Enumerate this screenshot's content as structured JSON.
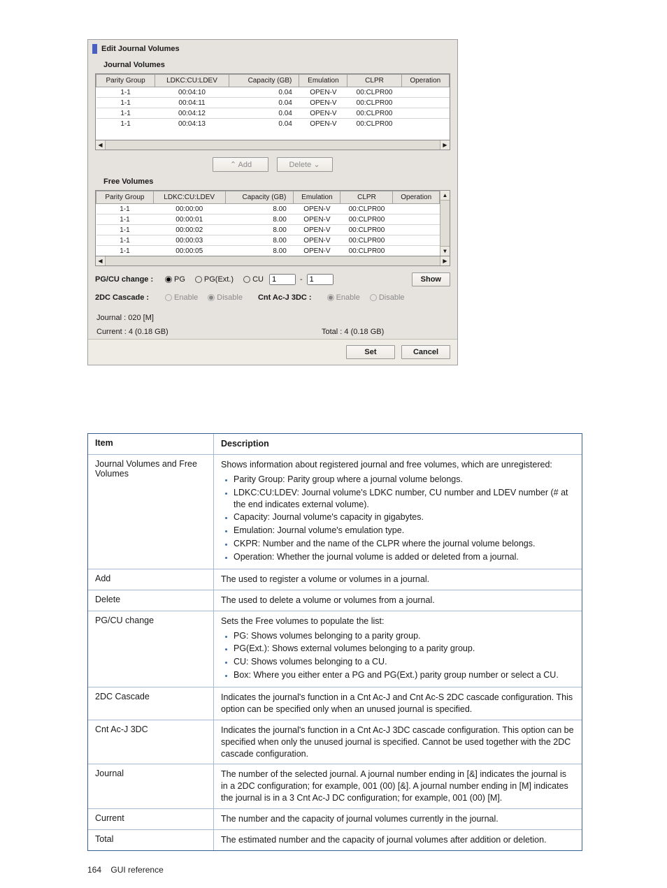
{
  "window": {
    "title": "Edit Journal Volumes",
    "section1_title": "Journal Volumes",
    "section2_title": "Free Volumes",
    "columns": {
      "parity_group": "Parity Group",
      "ldkc": "LDKC:CU:LDEV",
      "capacity": "Capacity (GB)",
      "emulation": "Emulation",
      "clpr": "CLPR",
      "operation": "Operation"
    },
    "journal_rows": [
      {
        "pg": "1-1",
        "ldkc": "00:04:10",
        "cap": "0.04",
        "emu": "OPEN-V",
        "clpr": "00:CLPR00",
        "op": ""
      },
      {
        "pg": "1-1",
        "ldkc": "00:04:11",
        "cap": "0.04",
        "emu": "OPEN-V",
        "clpr": "00:CLPR00",
        "op": ""
      },
      {
        "pg": "1-1",
        "ldkc": "00:04:12",
        "cap": "0.04",
        "emu": "OPEN-V",
        "clpr": "00:CLPR00",
        "op": ""
      },
      {
        "pg": "1-1",
        "ldkc": "00:04:13",
        "cap": "0.04",
        "emu": "OPEN-V",
        "clpr": "00:CLPR00",
        "op": ""
      }
    ],
    "free_rows": [
      {
        "pg": "1-1",
        "ldkc": "00:00:00",
        "cap": "8.00",
        "emu": "OPEN-V",
        "clpr": "00:CLPR00",
        "op": ""
      },
      {
        "pg": "1-1",
        "ldkc": "00:00:01",
        "cap": "8.00",
        "emu": "OPEN-V",
        "clpr": "00:CLPR00",
        "op": ""
      },
      {
        "pg": "1-1",
        "ldkc": "00:00:02",
        "cap": "8.00",
        "emu": "OPEN-V",
        "clpr": "00:CLPR00",
        "op": ""
      },
      {
        "pg": "1-1",
        "ldkc": "00:00:03",
        "cap": "8.00",
        "emu": "OPEN-V",
        "clpr": "00:CLPR00",
        "op": ""
      },
      {
        "pg": "1-1",
        "ldkc": "00:00:05",
        "cap": "8.00",
        "emu": "OPEN-V",
        "clpr": "00:CLPR00",
        "op": ""
      }
    ],
    "add_btn": "Add",
    "delete_btn": "Delete",
    "pg_cu_label": "PG/CU change :",
    "pg": "PG",
    "pgext": "PG(Ext.)",
    "cu": "CU",
    "field1": "1",
    "dash": "-",
    "field2": "1",
    "show": "Show",
    "cascade_label": "2DC Cascade :",
    "enable": "Enable",
    "disable": "Disable",
    "cnt_label": "Cnt Ac-J 3DC :",
    "journal_info": "Journal : 020 [M]",
    "current_info": "Current : 4 (0.18 GB)",
    "total_info": "Total : 4 (0.18 GB)",
    "set": "Set",
    "cancel": "Cancel"
  },
  "desc": {
    "h_item": "Item",
    "h_desc": "Description",
    "rows": [
      {
        "item": "Journal Volumes and Free Volumes",
        "intro": "Shows information about registered journal and free volumes, which are unregistered:",
        "bullets": [
          "Parity Group: Parity group where a journal volume belongs.",
          "LDKC:CU:LDEV: Journal volume's LDKC number, CU number and LDEV number (# at the end indicates external volume).",
          "Capacity: Journal volume's capacity in gigabytes.",
          "Emulation: Journal volume's emulation type.",
          "CKPR: Number and the name of the CLPR where the journal volume belongs.",
          "Operation: Whether the journal volume is added or deleted from a journal."
        ]
      },
      {
        "item": "Add",
        "text": "The used to register a volume or volumes in a journal."
      },
      {
        "item": "Delete",
        "text": "The used to delete a volume or volumes from a journal."
      },
      {
        "item": "PG/CU change",
        "intro": "Sets the Free volumes to populate the list:",
        "bullets": [
          "PG: Shows volumes belonging to a parity group.",
          "PG(Ext.): Shows external volumes belonging to a parity group.",
          "CU: Shows volumes belonging to a CU.",
          "Box: Where you either enter a PG and PG(Ext.) parity group number or select a CU."
        ]
      },
      {
        "item": "2DC Cascade",
        "text": "Indicates the journal's function in a Cnt Ac-J and Cnt Ac-S 2DC cascade configuration. This option can be specified only when an unused journal is specified."
      },
      {
        "item": "Cnt Ac-J 3DC",
        "text": "Indicates the journal's function in a Cnt Ac-J 3DC cascade configuration. This option can be specified when only the unused journal is specified. Cannot be used together with the 2DC cascade configuration."
      },
      {
        "item": "Journal",
        "text": "The number of the selected journal. A journal number ending in [&] indicates the journal is in a 2DC configuration; for example, 001 (00) [&]. A journal number ending in [M] indicates the journal is in a 3 Cnt Ac-J DC configuration; for example, 001 (00) [M]."
      },
      {
        "item": "Current",
        "text": "The number and the capacity of journal volumes currently in the journal."
      },
      {
        "item": "Total",
        "text": "The estimated number and the capacity of journal volumes after addition or deletion."
      }
    ]
  },
  "footer": {
    "page": "164",
    "section": "GUI reference"
  }
}
